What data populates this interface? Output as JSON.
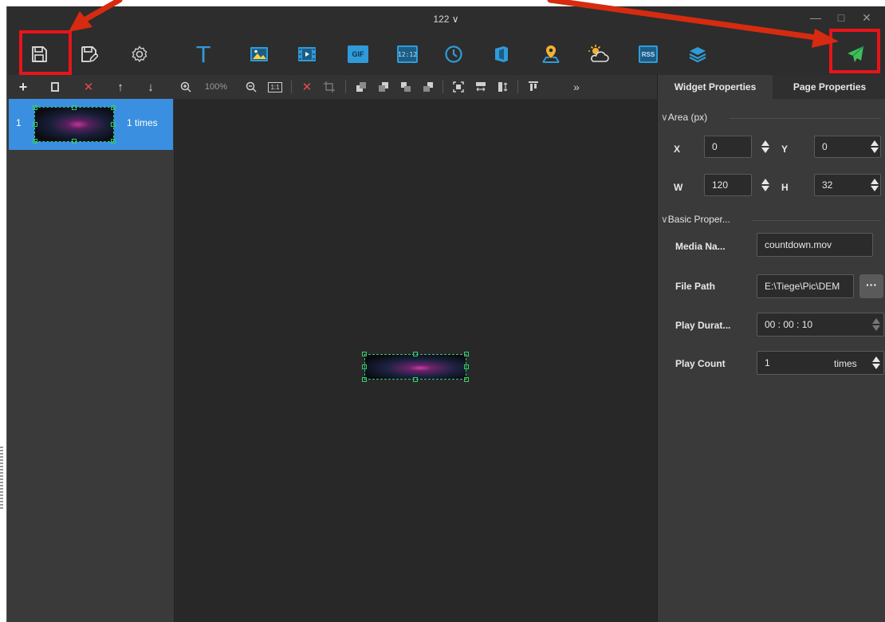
{
  "window": {
    "title": "122 ∨"
  },
  "title_controls": {
    "minimize": "—",
    "maximize": "□",
    "close": "✕"
  },
  "toolbar": {
    "items": [
      {
        "name": "save",
        "icon": "save-icon"
      },
      {
        "name": "save-as",
        "icon": "save-as-icon"
      },
      {
        "name": "settings",
        "icon": "gear-icon"
      },
      {
        "name": "text",
        "icon": "text-icon",
        "label": "T"
      },
      {
        "name": "image",
        "icon": "image-icon"
      },
      {
        "name": "video",
        "icon": "video-icon"
      },
      {
        "name": "gif",
        "icon": "gif-icon",
        "label": "GIF"
      },
      {
        "name": "digital-clock",
        "icon": "digital-clock-icon",
        "label": "12:12"
      },
      {
        "name": "analog-clock",
        "icon": "clock-icon"
      },
      {
        "name": "office",
        "icon": "office-icon"
      },
      {
        "name": "map",
        "icon": "location-icon"
      },
      {
        "name": "weather",
        "icon": "weather-icon"
      },
      {
        "name": "rss",
        "icon": "rss-icon",
        "label": "RSS"
      },
      {
        "name": "layers",
        "icon": "layers-icon"
      },
      {
        "name": "send",
        "icon": "send-icon"
      }
    ],
    "accent": "#2f9bd8",
    "send_color": "#3cc05a"
  },
  "subbar": {
    "add": "+",
    "delete": "✕",
    "up": "↑",
    "down": "↓",
    "zoom_level": "100%",
    "one_to_one": "1:1",
    "more": "»"
  },
  "pages": [
    {
      "index": "1",
      "play": "1 times"
    }
  ],
  "properties": {
    "tabs": [
      "Widget Properties",
      "Page Properties"
    ],
    "area": {
      "title": "Area (px)",
      "x_label": "X",
      "x": "0",
      "y_label": "Y",
      "y": "0",
      "w_label": "W",
      "w": "120",
      "h_label": "H",
      "h": "32"
    },
    "basic": {
      "title": "Basic Proper...",
      "media_name_label": "Media Na...",
      "media_name": "countdown.mov",
      "file_path_label": "File Path",
      "file_path": "E:\\Tiege\\Pic\\DEM",
      "more": "···",
      "duration_label": "Play Durat...",
      "duration": "00 : 00 : 10",
      "count_label": "Play Count",
      "count": "1",
      "count_unit": "times"
    }
  },
  "annotation_color": "#e8141a"
}
